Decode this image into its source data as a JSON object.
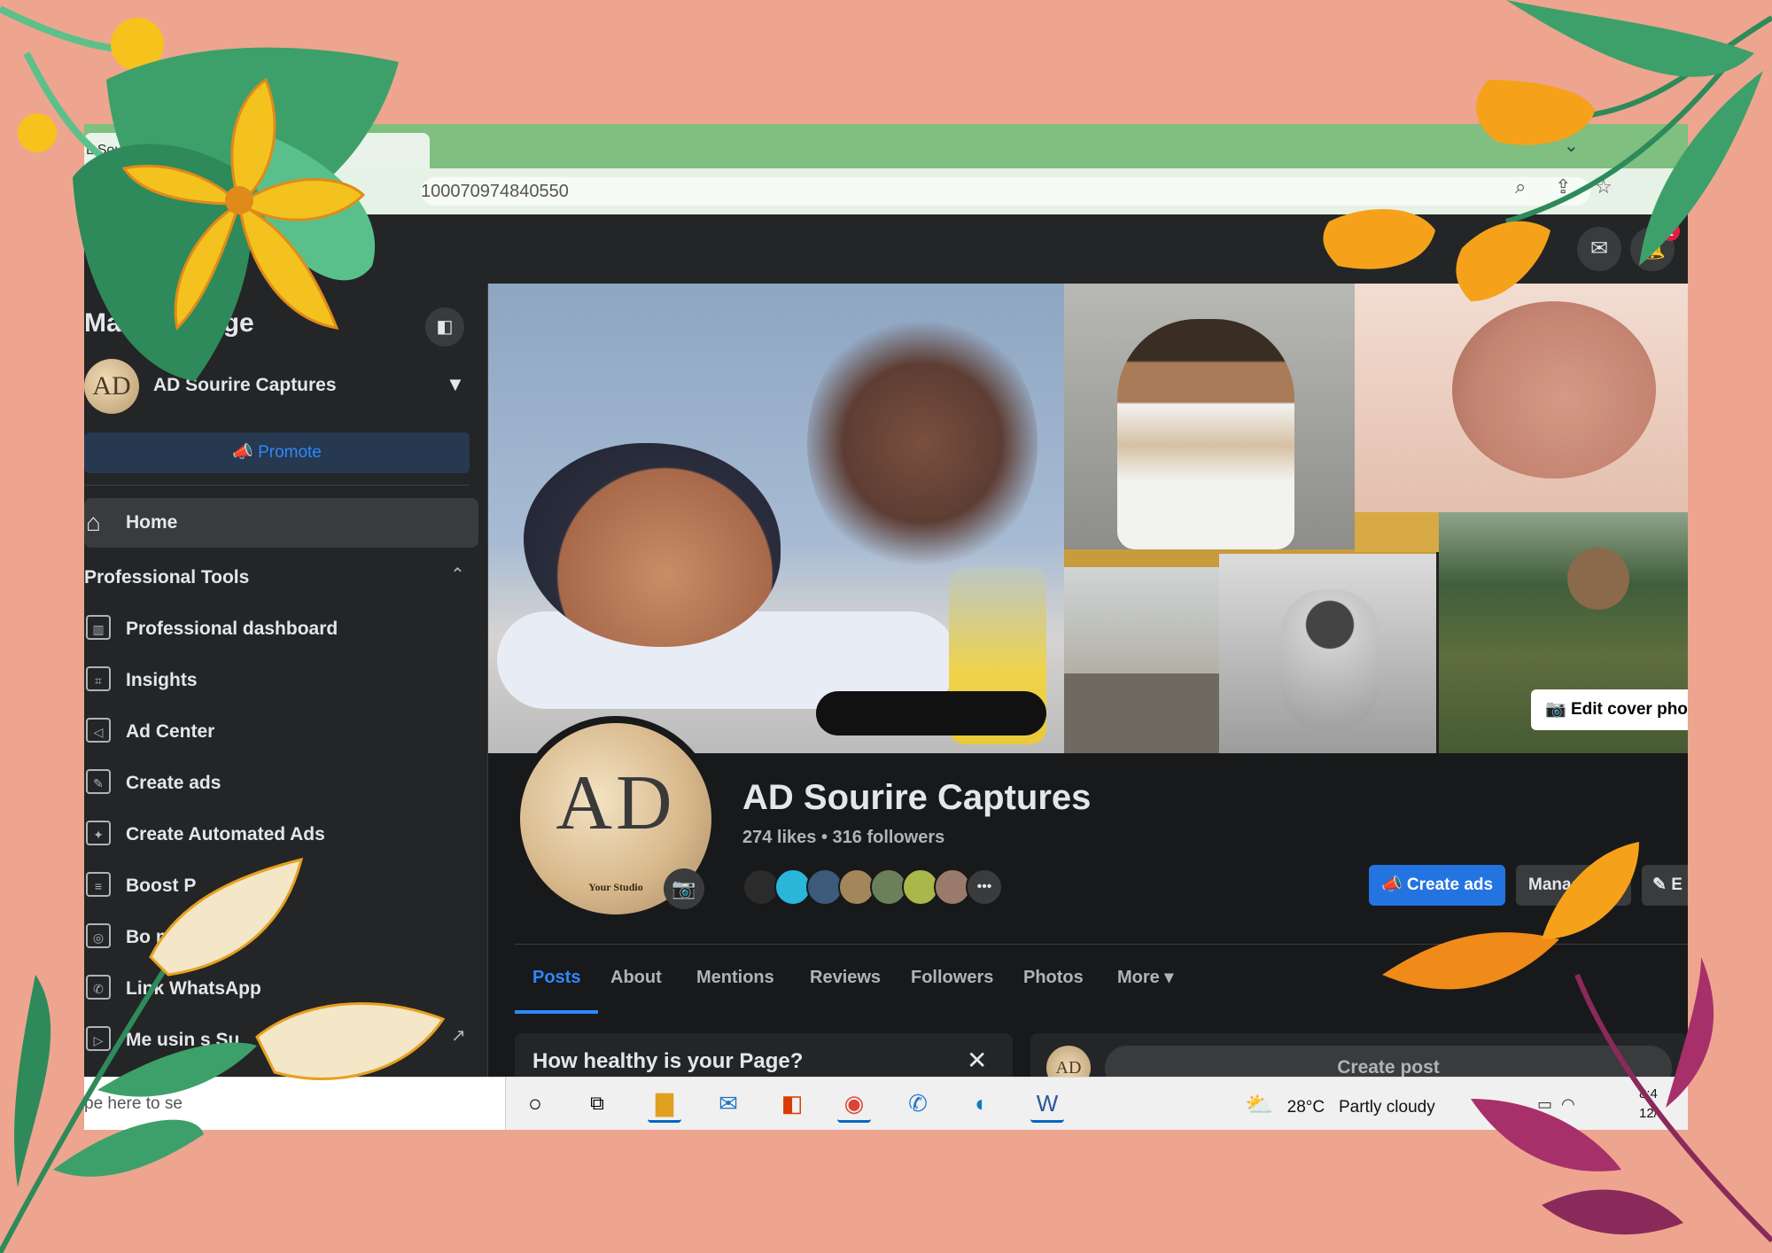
{
  "browser": {
    "tab_title": "L Sourire Ca",
    "url": "100070974840550"
  },
  "fb_top": {
    "notifications_count": "2"
  },
  "sidebar": {
    "title": "Manage Page",
    "page_name": "AD Sourire Captures",
    "page_avatar_text": "AD",
    "promote_label": "Promote",
    "home_label": "Home",
    "section_title": "Professional Tools",
    "items": [
      {
        "label": "Professional dashboard",
        "icon": "chart-icon"
      },
      {
        "label": "Insights",
        "icon": "insights-icon"
      },
      {
        "label": "Ad Center",
        "icon": "megaphone-icon"
      },
      {
        "label": "Create ads",
        "icon": "pencil-icon"
      },
      {
        "label": "Create Automated Ads",
        "icon": "wand-icon"
      },
      {
        "label": "Boost P",
        "icon": "boost-icon"
      },
      {
        "label": "Bo                  m Post",
        "icon": "instagram-icon"
      },
      {
        "label": "Link WhatsApp",
        "icon": "whatsapp-icon"
      },
      {
        "label": "Me       usin    s Su",
        "icon": "meta-icon"
      }
    ]
  },
  "profile": {
    "name": "AD Sourire Captures",
    "stats": "274 likes • 316 followers",
    "logo_text": "AD",
    "logo_subtext": "Your Studio",
    "edit_cover_label": "Edit cover phot",
    "create_ads_label": "Create ads",
    "manage_label": "Manag",
    "edit_label": "E"
  },
  "tabs": [
    {
      "label": "Posts",
      "active": true
    },
    {
      "label": "About"
    },
    {
      "label": "Mentions"
    },
    {
      "label": "Reviews"
    },
    {
      "label": "Followers"
    },
    {
      "label": "Photos"
    },
    {
      "label": "More ▾"
    }
  ],
  "cards": {
    "health_title": "How healthy is your Page?",
    "create_post_label": "Create post",
    "create_post_avatar": "AD"
  },
  "taskbar": {
    "search_placeholder": "pe here to se",
    "weather_temp": "28°C",
    "weather_desc": "Partly cloudy",
    "clock_time": "8:4",
    "clock_date": "12/"
  },
  "colors": {
    "background": "#eda58f",
    "fb_blue": "#2374e1",
    "fb_dark": "#18191a"
  }
}
